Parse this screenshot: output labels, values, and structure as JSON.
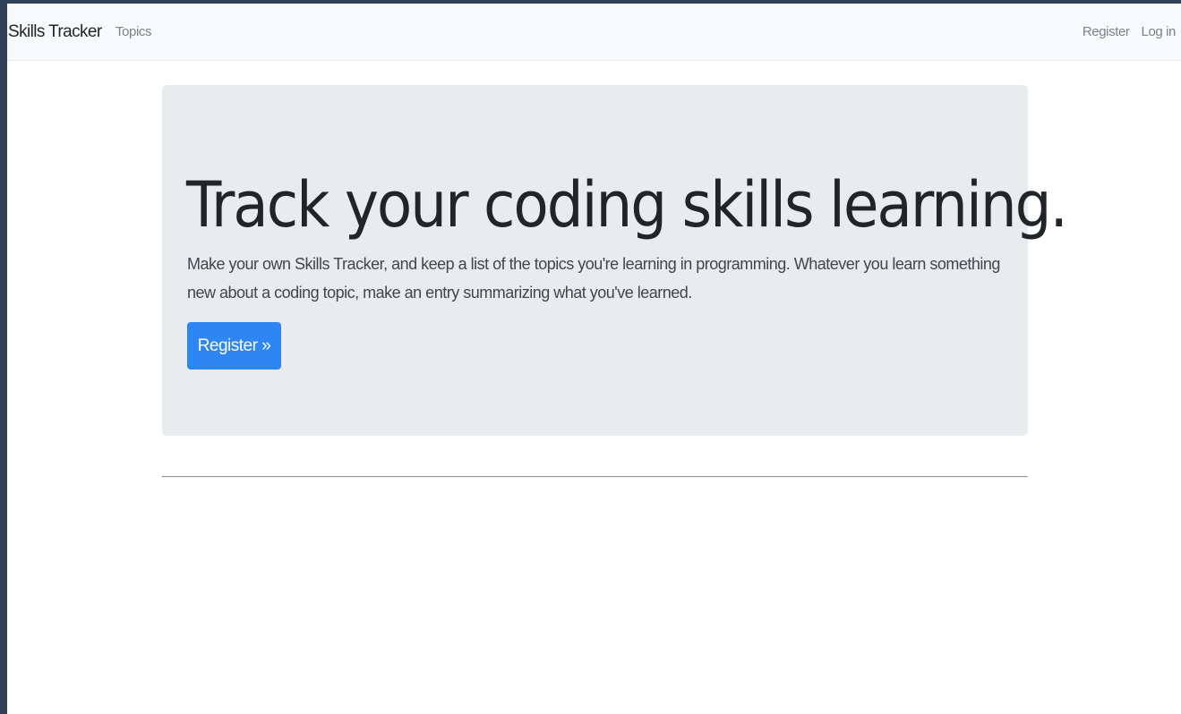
{
  "navbar": {
    "brand": "Skills Tracker",
    "links": {
      "topics": "Topics"
    },
    "right": {
      "register": "Register",
      "login": "Log in"
    }
  },
  "hero": {
    "title": "Track your coding skills learning.",
    "lead": "Make your own Skills Tracker, and keep a list of the topics you're learning in programming. Whatever you learn something new about a coding topic, make an entry summarizing what you've learned.",
    "button_label": "Register »",
    "button_color": "#2e86f5"
  }
}
